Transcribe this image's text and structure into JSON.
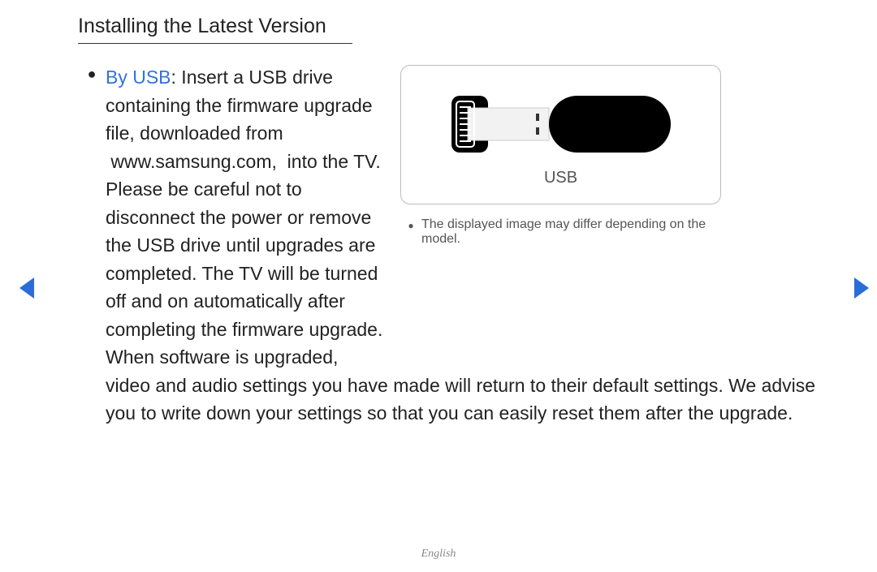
{
  "title": "Installing the Latest Version",
  "method_label": "By USB",
  "body_pre": ": Insert a USB drive containing the firmware upgrade file, downloaded from  www.samsung.com,  into the TV. Please be careful not to disconnect the power or remove the USB drive until upgrades are completed. The TV will be turned off and on automatically after completing the firmware upgrade. When software is upgraded,",
  "body_full": "video and audio settings you have made will return to their default settings. We advise you to write down your settings so that you can easily reset them after the upgrade.",
  "image_caption": "USB",
  "image_note": "The displayed image may differ depending on the model.",
  "footer": "English"
}
